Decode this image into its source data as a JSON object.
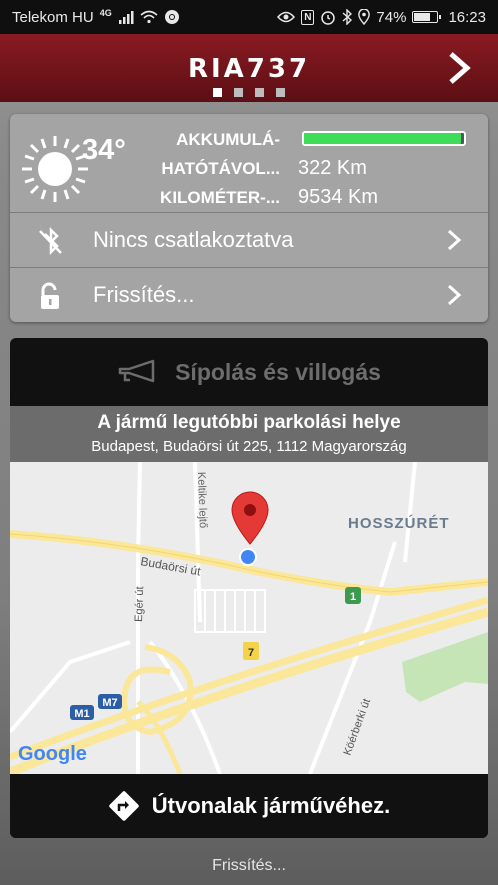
{
  "status_bar": {
    "carrier": "Telekom HU",
    "network": "4G",
    "battery_percent": "74%",
    "battery_level": 0.74,
    "time": "16:23",
    "icons": [
      "signal-icon",
      "wifi-icon",
      "chrome-icon",
      "eye-icon",
      "nfc-icon",
      "alarm-icon",
      "bluetooth-icon",
      "location-icon",
      "battery-icon"
    ]
  },
  "header": {
    "title": "RIA737",
    "page_count": 4,
    "active_page": 0,
    "accent_color": "#8a1a22"
  },
  "vehicle": {
    "temperature": "34°",
    "battery_label": "AKKUMULÁ-",
    "battery_level": 0.98,
    "battery_bar_color": "#3fdc5a",
    "range_label": "HATÓTÁVOL...",
    "range_value": "322 Km",
    "odometer_label": "KILOMÉTER-...",
    "odometer_value": "9534 Km",
    "weather_icon": "sun-icon"
  },
  "connection": {
    "label": "Nincs csatlakoztatva",
    "icon": "bluetooth-off-icon"
  },
  "refresh_row": {
    "label": "Frissítés...",
    "icon": "unlock-icon"
  },
  "horn": {
    "label": "Sípolás és villogás",
    "icon": "horn-icon"
  },
  "parking": {
    "title": "A jármű legutóbbi parkolási helye",
    "address": "Budapest, Budaörsi út 225, 1112 Magyarország"
  },
  "map": {
    "labels": {
      "budaorsi": "Budaörsi út",
      "eger": "Egér út",
      "keltike": "Keltike lejtő",
      "hosszuret": "HOSSZÚRÉT",
      "koerberki": "Köérberki út",
      "r1": "1",
      "r7": "7",
      "m1": "M1",
      "m7": "M7",
      "google": "Google"
    }
  },
  "route": {
    "label": "Útvonalak járművéhez.",
    "icon": "directions-icon"
  },
  "footer": {
    "refresh": "Frissítés..."
  }
}
